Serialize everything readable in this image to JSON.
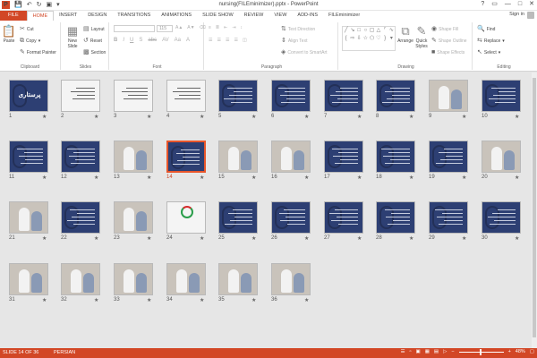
{
  "window": {
    "title": "nursing(FILEminimizer).pptx - PowerPoint",
    "app_icon": "P",
    "controls": [
      "?",
      "▭",
      "—",
      "□",
      "✕"
    ]
  },
  "tabs": [
    "FILE",
    "HOME",
    "INSERT",
    "DESIGN",
    "TRANSITIONS",
    "ANIMATIONS",
    "SLIDE SHOW",
    "REVIEW",
    "VIEW",
    "ADD-INS",
    "FILEminimizer"
  ],
  "active_tab": "HOME",
  "signin": "Sign in",
  "ribbon": {
    "clipboard": {
      "label": "Clipboard",
      "paste": "Paste",
      "cut": "Cut",
      "copy": "Copy",
      "format_painter": "Format Painter"
    },
    "slides": {
      "label": "Slides",
      "new_slide": "New Slide",
      "layout": "Layout",
      "reset": "Reset",
      "section": "Section"
    },
    "font": {
      "label": "Font",
      "size": "115"
    },
    "paragraph": {
      "label": "Paragraph",
      "text_direction": "Text Direction",
      "align_text": "Align Text",
      "convert_smartart": "Convert to SmartArt"
    },
    "drawing": {
      "label": "Drawing",
      "arrange": "Arrange",
      "quick_styles": "Quick Styles",
      "shape_fill": "Shape Fill",
      "shape_outline": "Shape Outline",
      "shape_effects": "Shape Effects"
    },
    "editing": {
      "label": "Editing",
      "find": "Find",
      "replace": "Replace",
      "select": "Select"
    }
  },
  "slides": [
    {
      "num": "1",
      "kind": "title",
      "title_text": "پرستاری"
    },
    {
      "num": "2",
      "kind": "white"
    },
    {
      "num": "3",
      "kind": "white"
    },
    {
      "num": "4",
      "kind": "white"
    },
    {
      "num": "5",
      "kind": "text"
    },
    {
      "num": "6",
      "kind": "text"
    },
    {
      "num": "7",
      "kind": "text"
    },
    {
      "num": "8",
      "kind": "text"
    },
    {
      "num": "9",
      "kind": "photo"
    },
    {
      "num": "10",
      "kind": "text"
    },
    {
      "num": "11",
      "kind": "text"
    },
    {
      "num": "12",
      "kind": "text"
    },
    {
      "num": "13",
      "kind": "photo"
    },
    {
      "num": "14",
      "kind": "text",
      "selected": true
    },
    {
      "num": "15",
      "kind": "photo"
    },
    {
      "num": "16",
      "kind": "photo"
    },
    {
      "num": "17",
      "kind": "text"
    },
    {
      "num": "18",
      "kind": "text"
    },
    {
      "num": "19",
      "kind": "text"
    },
    {
      "num": "20",
      "kind": "photo"
    },
    {
      "num": "21",
      "kind": "photo"
    },
    {
      "num": "22",
      "kind": "text"
    },
    {
      "num": "23",
      "kind": "photo"
    },
    {
      "num": "24",
      "kind": "logo"
    },
    {
      "num": "25",
      "kind": "text"
    },
    {
      "num": "26",
      "kind": "text"
    },
    {
      "num": "27",
      "kind": "text"
    },
    {
      "num": "28",
      "kind": "text"
    },
    {
      "num": "29",
      "kind": "text"
    },
    {
      "num": "30",
      "kind": "text"
    },
    {
      "num": "31",
      "kind": "photo"
    },
    {
      "num": "32",
      "kind": "photo"
    },
    {
      "num": "33",
      "kind": "photo"
    },
    {
      "num": "34",
      "kind": "photo"
    },
    {
      "num": "35",
      "kind": "photo"
    },
    {
      "num": "36",
      "kind": "photo"
    }
  ],
  "star_glyph": "★",
  "status": {
    "slide_info": "SLIDE 14 OF 36",
    "language": "PERSIAN",
    "zoom": "48%",
    "zoom_fraction": 0.48
  }
}
